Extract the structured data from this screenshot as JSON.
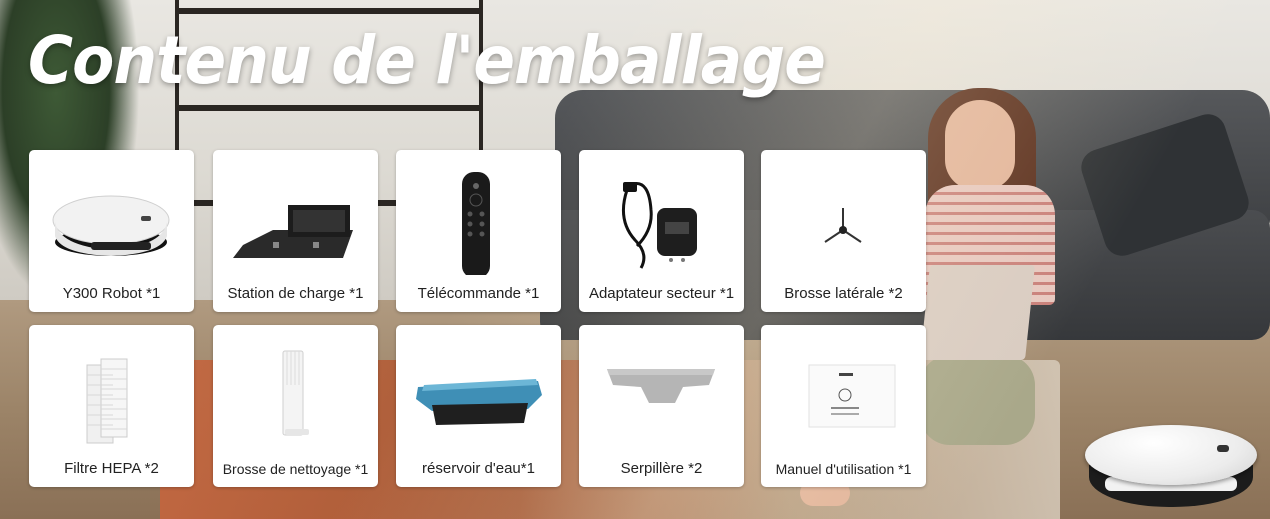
{
  "heading": "Contenu de l'emballage",
  "items": [
    {
      "label": "Y300 Robot *1",
      "icon": "robot-vacuum-icon"
    },
    {
      "label": "Station de charge *1",
      "icon": "charging-station-icon"
    },
    {
      "label": "Télécommande *1",
      "icon": "remote-control-icon"
    },
    {
      "label": "Adaptateur secteur *1",
      "icon": "power-adapter-icon"
    },
    {
      "label": "Brosse latérale *2",
      "icon": "side-brush-icon"
    },
    {
      "label": "Filtre HEPA *2",
      "icon": "hepa-filter-icon"
    },
    {
      "label": "Brosse de nettoyage *1",
      "icon": "cleaning-brush-icon"
    },
    {
      "label": "réservoir d'eau*1",
      "icon": "water-tank-icon"
    },
    {
      "label": "Serpillère *2",
      "icon": "mop-pad-icon"
    },
    {
      "label": "Manuel d'utilisation *1",
      "icon": "user-manual-icon"
    }
  ],
  "colors": {
    "card": "#ffffff",
    "title": "#ffffff",
    "label": "#222222"
  }
}
